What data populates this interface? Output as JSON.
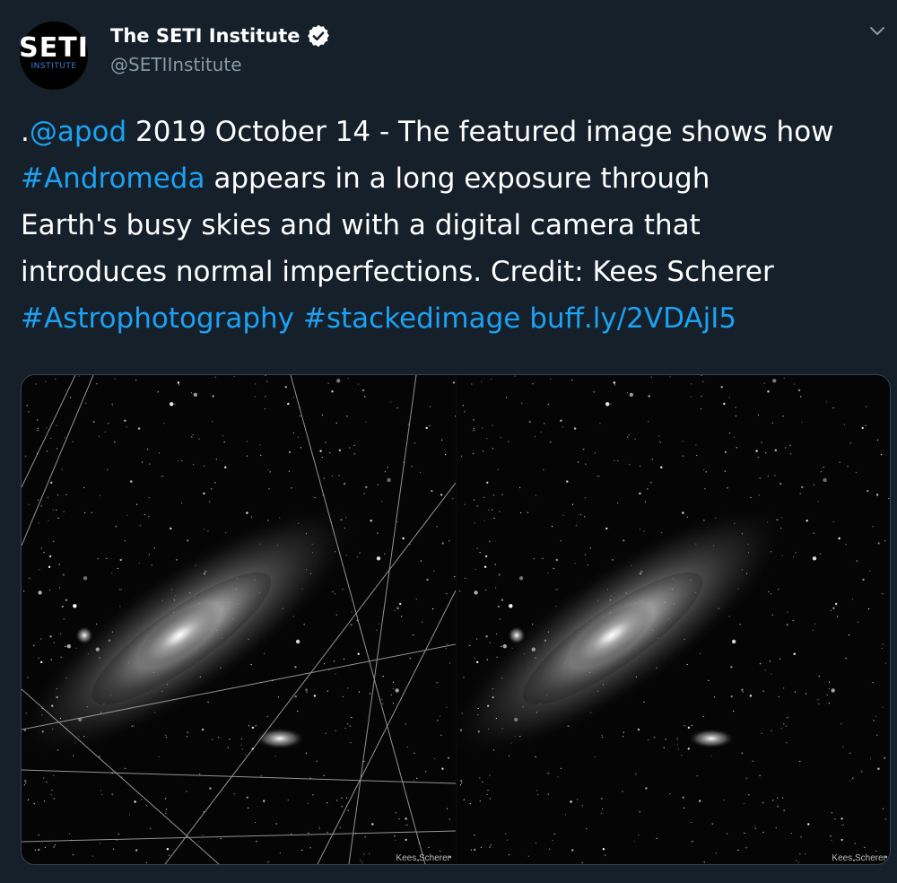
{
  "account": {
    "avatar_main": "SETI",
    "avatar_sub": "INSTITUTE",
    "display_name": "The SETI Institute",
    "verified": true,
    "handle": "@SETIInstitute"
  },
  "tweet": {
    "prefix": ".",
    "mention": "@apod",
    "text_1": " 2019 October 14 - The featured image shows how ",
    "hashtag_andromeda": "#Andromeda",
    "text_2": " appears in a long exposure through Earth's busy skies and with a digital camera that introduces normal imperfections. Credit: Kees Scherer ",
    "hashtag_astro": "#Astrophotography",
    "hashtag_stacked": "#stackedimage",
    "link": "buff.ly/2VDAjI5"
  },
  "media": {
    "left_credit": "Kees Scherer",
    "right_credit": "Kees Scherer"
  },
  "colors": {
    "background": "#15202b",
    "link": "#1da1f2",
    "secondary_text": "#8899a6",
    "avatar_accent": "#3b7bd6"
  },
  "icons": {
    "verified": "verified-badge-icon",
    "more": "chevron-down-icon"
  }
}
